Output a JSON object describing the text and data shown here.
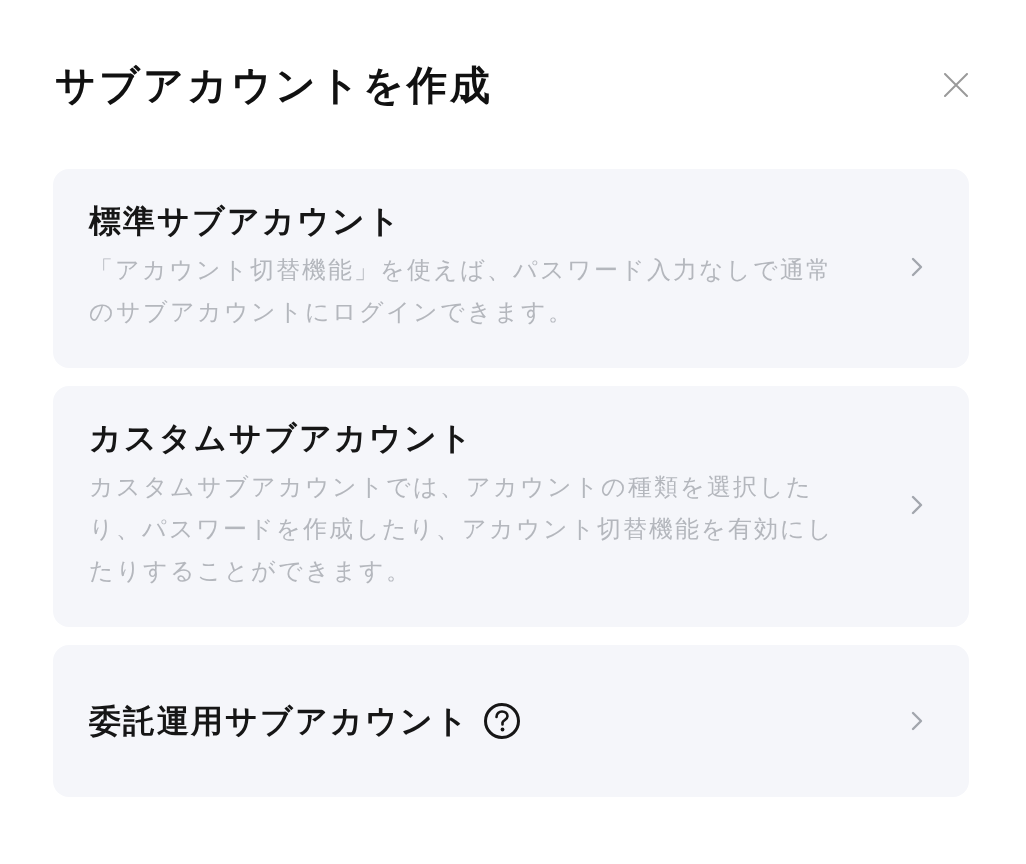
{
  "dialog": {
    "title": "サブアカウントを作成"
  },
  "options": [
    {
      "title": "標準サブアカウント",
      "description": "「アカウント切替機能」を使えば、パスワード入力なしで通常のサブアカウントにログインできます。",
      "help_icon": false
    },
    {
      "title": "カスタムサブアカウント",
      "description": "カスタムサブアカウントでは、アカウントの種類を選択したり、パスワードを作成したり、アカウント切替機能を有効にしたりすることができます。",
      "help_icon": false
    },
    {
      "title": "委託運用サブアカウント",
      "help_icon": true
    }
  ]
}
